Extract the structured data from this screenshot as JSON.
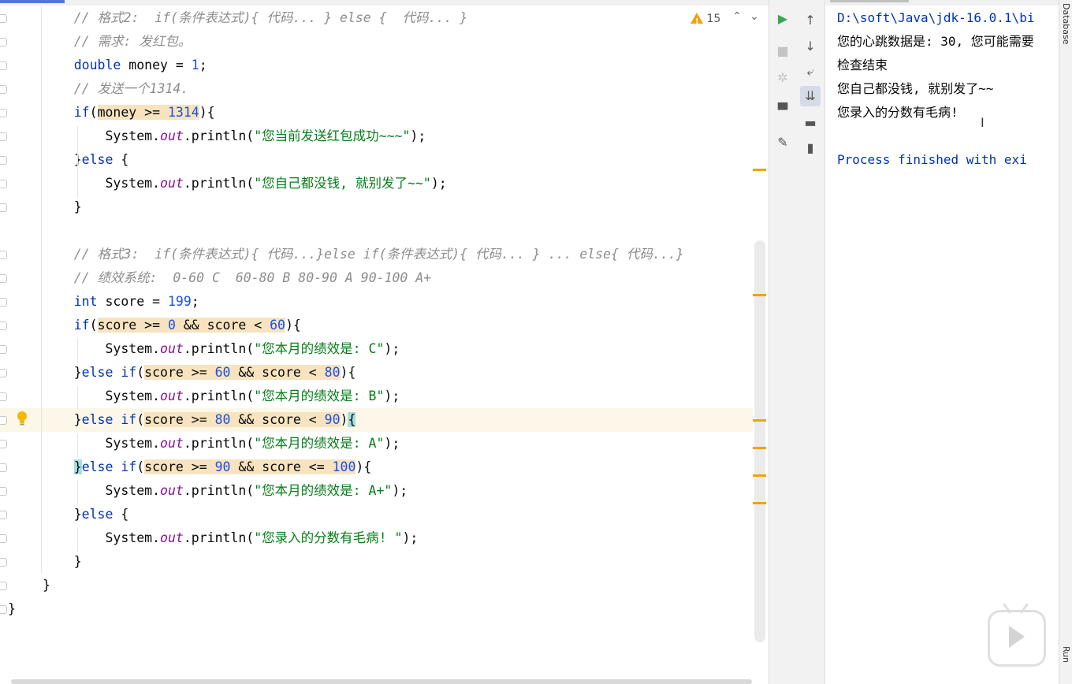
{
  "editor": {
    "warning_count": "15",
    "lines": [
      [
        {
          "t": "    "
        },
        {
          "t": "// 格式2:  if(条件表达式){ 代码... } else {  代码... }",
          "c": "cmt"
        }
      ],
      [
        {
          "t": "    "
        },
        {
          "t": "// 需求: 发红包。",
          "c": "cmt"
        }
      ],
      [
        {
          "t": "    "
        },
        {
          "t": "double",
          "c": "kw"
        },
        {
          "t": " money = "
        },
        {
          "t": "1",
          "c": "num"
        },
        {
          "t": ";"
        }
      ],
      [
        {
          "t": "    "
        },
        {
          "t": "// 发送一个1314.",
          "c": "cmt"
        }
      ],
      [
        {
          "t": "    "
        },
        {
          "t": "if",
          "c": "kw"
        },
        {
          "t": "("
        },
        {
          "t": "money >= ",
          "c": "hl"
        },
        {
          "t": "1314",
          "c": "num hl"
        },
        {
          "t": "){"
        }
      ],
      [
        {
          "t": "        System."
        },
        {
          "t": "out",
          "c": "fld"
        },
        {
          "t": ".println("
        },
        {
          "t": "\"您当前发送红包成功~~~\"",
          "c": "str"
        },
        {
          "t": ");"
        }
      ],
      [
        {
          "t": "    }"
        },
        {
          "t": "else",
          "c": "kw"
        },
        {
          "t": " {"
        }
      ],
      [
        {
          "t": "        System."
        },
        {
          "t": "out",
          "c": "fld"
        },
        {
          "t": ".println("
        },
        {
          "t": "\"您自己都没钱, 就别发了~~\"",
          "c": "str"
        },
        {
          "t": ");"
        }
      ],
      [
        {
          "t": "    }"
        }
      ],
      [
        {
          "t": ""
        }
      ],
      [
        {
          "t": "    "
        },
        {
          "t": "// 格式3:  if(条件表达式){ 代码...}else if(条件表达式){ 代码... } ... else{ 代码...}",
          "c": "cmt"
        }
      ],
      [
        {
          "t": "    "
        },
        {
          "t": "// 绩效系统:  0-60 C  60-80 B 80-90 A 90-100 A+",
          "c": "cmt"
        }
      ],
      [
        {
          "t": "    "
        },
        {
          "t": "int",
          "c": "kw"
        },
        {
          "t": " score = "
        },
        {
          "t": "199",
          "c": "num"
        },
        {
          "t": ";"
        }
      ],
      [
        {
          "t": "    "
        },
        {
          "t": "if",
          "c": "kw"
        },
        {
          "t": "("
        },
        {
          "t": "score >= ",
          "c": "hl"
        },
        {
          "t": "0",
          "c": "num hl"
        },
        {
          "t": " && score < ",
          "c": "hl"
        },
        {
          "t": "60",
          "c": "num hl"
        },
        {
          "t": "){"
        }
      ],
      [
        {
          "t": "        System."
        },
        {
          "t": "out",
          "c": "fld"
        },
        {
          "t": ".println("
        },
        {
          "t": "\"您本月的绩效是: C\"",
          "c": "str"
        },
        {
          "t": ");"
        }
      ],
      [
        {
          "t": "    }"
        },
        {
          "t": "else if",
          "c": "kw"
        },
        {
          "t": "("
        },
        {
          "t": "score >= ",
          "c": "hl"
        },
        {
          "t": "60",
          "c": "num hl"
        },
        {
          "t": " && score < ",
          "c": "hl"
        },
        {
          "t": "80",
          "c": "num hl"
        },
        {
          "t": "){"
        }
      ],
      [
        {
          "t": "        System."
        },
        {
          "t": "out",
          "c": "fld"
        },
        {
          "t": ".println("
        },
        {
          "t": "\"您本月的绩效是: B\"",
          "c": "str"
        },
        {
          "t": ");"
        }
      ],
      [
        {
          "t": "    }"
        },
        {
          "t": "else if",
          "c": "kw"
        },
        {
          "t": "("
        },
        {
          "t": "score >= ",
          "c": "hl"
        },
        {
          "t": "80",
          "c": "num hl"
        },
        {
          "t": " && score < ",
          "c": "hl"
        },
        {
          "t": "90",
          "c": "num hl"
        },
        {
          "t": ")"
        },
        {
          "t": "{",
          "c": "br"
        }
      ],
      [
        {
          "t": "        System."
        },
        {
          "t": "out",
          "c": "fld"
        },
        {
          "t": ".println("
        },
        {
          "t": "\"您本月的绩效是: A\"",
          "c": "str"
        },
        {
          "t": ");"
        }
      ],
      [
        {
          "t": "    "
        },
        {
          "t": "}",
          "c": "br"
        },
        {
          "t": "else if",
          "c": "kw"
        },
        {
          "t": "("
        },
        {
          "t": "score >= ",
          "c": "hl"
        },
        {
          "t": "90",
          "c": "num hl"
        },
        {
          "t": " && score <= ",
          "c": "hl"
        },
        {
          "t": "100",
          "c": "num hl"
        },
        {
          "t": "){"
        }
      ],
      [
        {
          "t": "        System."
        },
        {
          "t": "out",
          "c": "fld"
        },
        {
          "t": ".println("
        },
        {
          "t": "\"您本月的绩效是: A+\"",
          "c": "str"
        },
        {
          "t": ");"
        }
      ],
      [
        {
          "t": "    }"
        },
        {
          "t": "else",
          "c": "kw"
        },
        {
          "t": " {"
        }
      ],
      [
        {
          "t": "        System."
        },
        {
          "t": "out",
          "c": "fld"
        },
        {
          "t": ".println("
        },
        {
          "t": "\"您录入的分数有毛病! \"",
          "c": "str"
        },
        {
          "t": ");"
        }
      ],
      [
        {
          "t": "    }"
        }
      ],
      [
        {
          "t": "}"
        }
      ],
      [
        {
          "t": "}"
        }
      ]
    ]
  },
  "console": {
    "lines": [
      "D:\\soft\\Java\\jdk-16.0.1\\bi",
      "您的心跳数据是: 30, 您可能需要",
      "检查结束",
      "您自己都没钱, 就别发了~~",
      "您录入的分数有毛病!",
      "",
      "Process finished with exi"
    ]
  },
  "sidebar": {
    "database_label": "Database",
    "run_label": "Run"
  },
  "colors": {
    "keyword": "#0033b3",
    "number": "#1750eb",
    "string": "#067d17",
    "comment": "#8c8c8c",
    "highlight": "#f7e3bf",
    "current_line": "#fcf7e8",
    "warning": "#f0a30a"
  }
}
